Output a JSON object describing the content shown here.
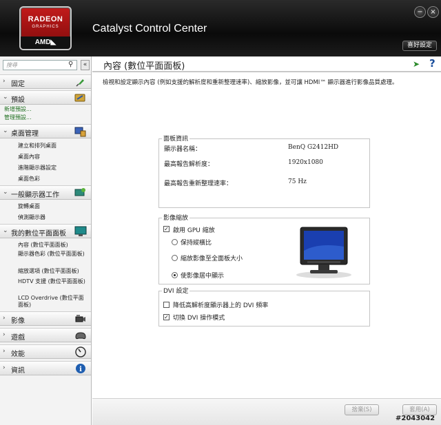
{
  "header": {
    "logo": {
      "brand": "RADEON",
      "sub": "GRAPHICS",
      "maker": "AMD◣"
    },
    "app_title": "Catalyst Control Center",
    "preferences_button": "喜好設定",
    "minimize_glyph": "−",
    "close_glyph": "×"
  },
  "sidebar": {
    "search_placeholder": "搜尋",
    "collapse_glyph": "«",
    "categories": [
      {
        "label": "固定",
        "expanded": false,
        "icon": "pin-icon",
        "chevron": "›"
      },
      {
        "label": "預設",
        "expanded": true,
        "icon": "presets-icon",
        "chevron": "⌄",
        "items": [
          "新增預設...",
          "管理預設..."
        ]
      },
      {
        "label": "桌面管理",
        "expanded": true,
        "icon": "desktop-management-icon",
        "chevron": "⌄",
        "items": [
          "建立和排列桌面",
          "桌面內容",
          "進階顯示器設定",
          "桌面色彩"
        ]
      },
      {
        "label": "一般顯示器工作",
        "expanded": true,
        "icon": "display-tasks-icon",
        "chevron": "⌄",
        "items": [
          "旋轉桌面",
          "偵測顯示器"
        ]
      },
      {
        "label": "我的數位平面面板",
        "expanded": true,
        "icon": "flat-panel-icon",
        "chevron": "⌄",
        "items": [
          "內容 (數位平面面板)",
          "顯示器色彩 (數位平面面板)",
          "縮放選項 (數位平面面板)",
          "HDTV 支援 (數位平面面板)",
          "LCD Overdrive (數位平面面板)"
        ]
      },
      {
        "label": "影像",
        "expanded": false,
        "icon": "video-camera-icon",
        "chevron": "›"
      },
      {
        "label": "遊戲",
        "expanded": false,
        "icon": "gamepad-icon",
        "chevron": "›"
      },
      {
        "label": "效能",
        "expanded": false,
        "icon": "gauge-icon",
        "chevron": "›"
      },
      {
        "label": "資訊",
        "expanded": false,
        "icon": "info-icon",
        "chevron": "›"
      }
    ]
  },
  "main": {
    "title": "內容 (數位平面面板)",
    "description": "檢視和設定顯示內容 (例如支援的解析度和重新整理速率)、縮放影像，並可讓 HDMI™ 顯示器進行影像品質處理。",
    "panel_info": {
      "title": "面板資訊",
      "rows": [
        {
          "label": "顯示器名稱：",
          "value": "BenQ G2412HD"
        },
        {
          "label": "最高報告解析度：",
          "value": "1920x1080"
        },
        {
          "label": "最高報告重新整理速率：",
          "value": "75 Hz"
        }
      ]
    },
    "scaling": {
      "title": "影像縮放",
      "gpu_scaling": {
        "label": "啟用 GPU 縮放",
        "checked": true
      },
      "options": [
        {
          "label": "保持縱橫比",
          "selected": false
        },
        {
          "label": "縮放影像至全面板大小",
          "selected": false
        },
        {
          "label": "使影像居中顯示",
          "selected": true
        }
      ]
    },
    "dvi": {
      "title": "DVI 設定",
      "options": [
        {
          "label": "降低高解析度顯示器上的 DVI 頻率",
          "checked": false
        },
        {
          "label": "切換 DVI 操作模式",
          "checked": true
        }
      ]
    }
  },
  "footer": {
    "discard_button": "捨棄(S)",
    "apply_button": "套用(A)"
  },
  "watermark": "#2043042",
  "colors": {
    "header_bg": "#111111",
    "logo_red": "#c21b1b",
    "link_green": "#207020",
    "help_blue": "#1b4f9c",
    "sidebar_bg": "#f3f3f3"
  }
}
